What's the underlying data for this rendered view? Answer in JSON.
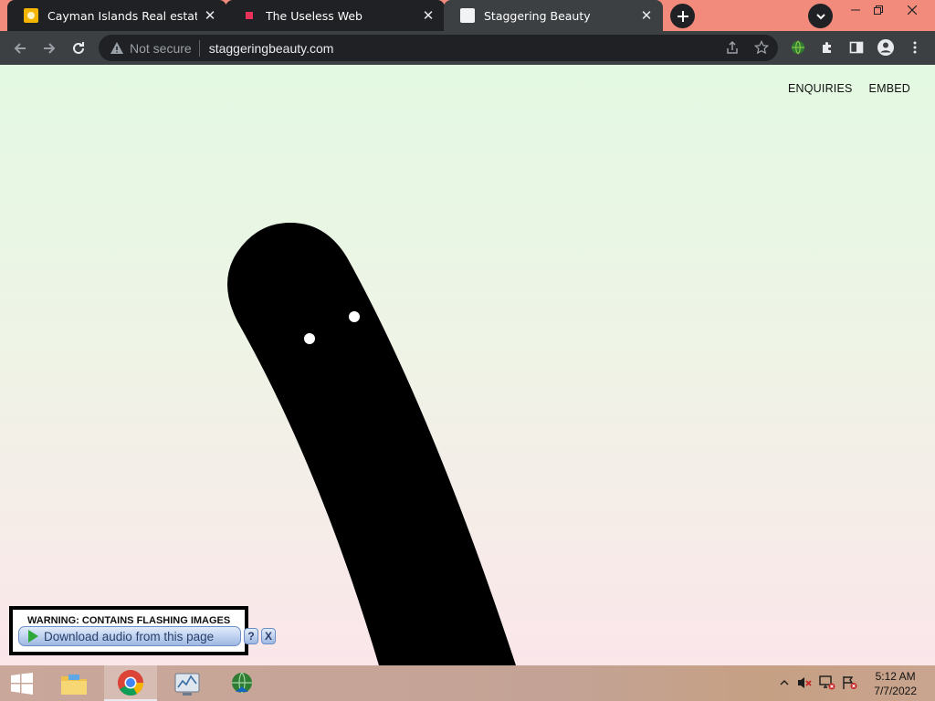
{
  "browser": {
    "tabs": [
      {
        "title": "Cayman Islands Real estate Prope",
        "favicon": "cayman-favicon-icon"
      },
      {
        "title": "The Useless Web",
        "favicon": "useless-web-favicon-icon"
      },
      {
        "title": "Staggering Beauty",
        "favicon": "page-favicon-icon",
        "active": true
      }
    ],
    "security_label": "Not secure",
    "url": "staggeringbeauty.com"
  },
  "page": {
    "nav": {
      "enquiries": "ENQUIRIES",
      "embed": "EMBED"
    },
    "warning": "WARNING: CONTAINS FLASHING IMAGES",
    "download_audio": "Download audio from this page",
    "help_label": "?",
    "close_label": "X"
  },
  "taskbar": {
    "time": "5:12 AM",
    "date": "7/7/2022"
  },
  "colors": {
    "tabstrip": "#f28b7c",
    "toolbar": "#3c4043",
    "creature": "#000000",
    "page_top": "#e3f9e2",
    "page_bottom": "#fbe6ea"
  }
}
